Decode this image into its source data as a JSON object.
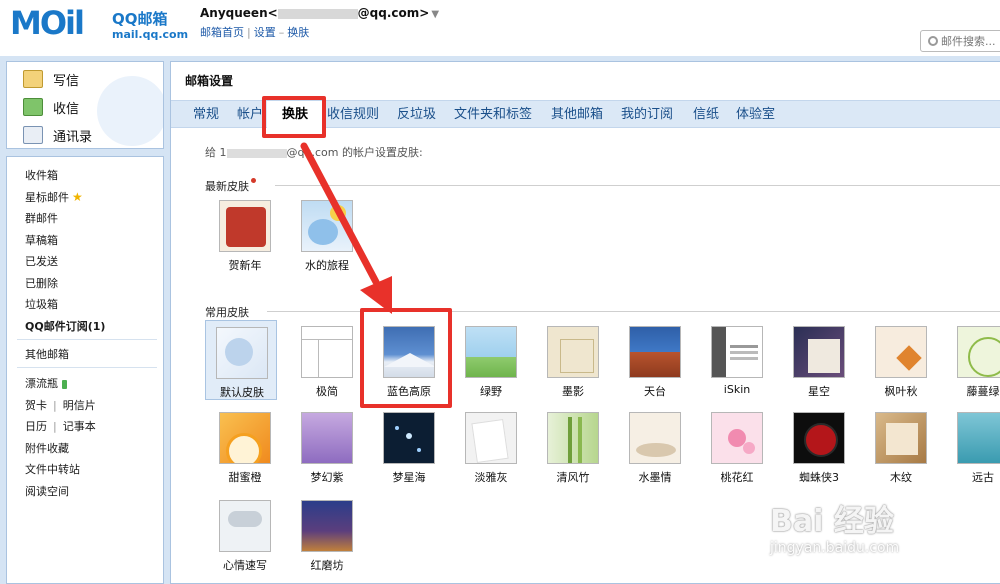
{
  "header": {
    "logo_mark": "MOil",
    "logo_brand": "QQ邮箱",
    "logo_domain": "mail.qq.com",
    "account_name": "Anyqueen<",
    "account_domain": "@qq.com>",
    "account_caret": "▼",
    "nav": [
      "邮箱首页",
      "设置",
      "换肤"
    ],
    "nav_sep": "|",
    "nav_dash": "–",
    "search_placeholder": "邮件搜索..."
  },
  "sidebar": {
    "actions": [
      "写信",
      "收信",
      "通讯录"
    ],
    "folders": [
      "收件箱",
      "星标邮件",
      "群邮件",
      "草稿箱",
      "已发送",
      "已删除",
      "垃圾箱",
      "QQ邮件订阅(1)"
    ],
    "others": "其他邮箱",
    "apps": {
      "bottle": "漂流瓶",
      "card": "贺卡",
      "postcard": "明信片",
      "calendar": "日历",
      "notes": "记事本",
      "attachments": "附件收藏",
      "transfer": "文件中转站",
      "reading": "阅读空间"
    },
    "pipe": "|"
  },
  "main": {
    "title": "邮箱设置",
    "tabs": [
      "常规",
      "帐户",
      "换肤",
      "收信规则",
      "反垃圾",
      "文件夹和标签",
      "其他邮箱",
      "我的订阅",
      "信纸",
      "体验室"
    ],
    "active_tab": "换肤",
    "info_prefix": "给 1",
    "info_suffix": "@qq.com 的帐户设置皮肤:",
    "section_new": "最新皮肤",
    "section_common": "常用皮肤",
    "new_skins": [
      "贺新年",
      "水的旅程"
    ],
    "common_skins_row1": [
      "默认皮肤",
      "极简",
      "蓝色高原",
      "绿野",
      "墨影",
      "天台",
      "iSkin",
      "星空",
      "枫叶秋",
      "藤蔓绿"
    ],
    "common_skins_row2": [
      "甜蜜橙",
      "梦幻紫",
      "梦星海",
      "淡雅灰",
      "清风竹",
      "水墨情",
      "桃花红",
      "蜘蛛侠3",
      "木纹",
      "远古"
    ],
    "common_skins_row3": [
      "心情速写",
      "红磨坊"
    ],
    "selected_skin": "默认皮肤"
  },
  "annotations": {
    "highlight_color": "#e8312a"
  },
  "watermark": {
    "brand": "Bai 经验",
    "url": "jingyan.baidu.com"
  }
}
